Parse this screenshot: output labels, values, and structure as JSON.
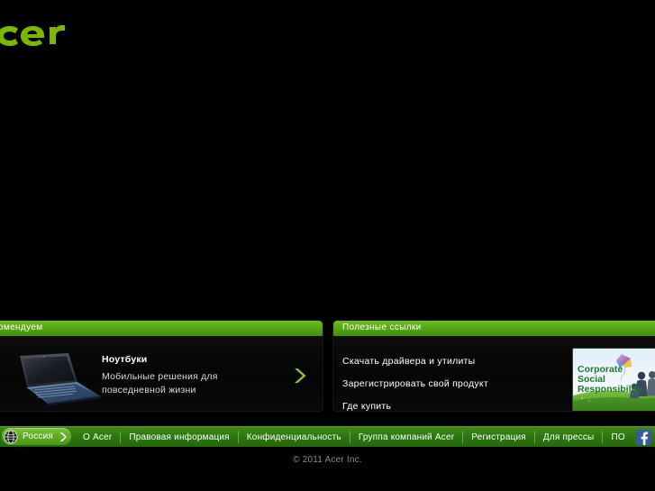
{
  "brand": {
    "logo_text": "acer",
    "logo_color": "#7ab800",
    "logo_name": "acer-logo"
  },
  "theme": {
    "background": "#000000",
    "accent_green": "#7ab800",
    "panel_header_green": "#56a714",
    "footer_green": "#2f7a10",
    "region_pill_green": "#5faa22",
    "facebook_blue": "#3b5998",
    "text_primary": "#ffffff",
    "text_muted": "#d8d8d8",
    "copyright_gray": "#8c8c8c"
  },
  "panels": {
    "recommended": {
      "header": "омендуем",
      "header_full": "Рекомендуем",
      "promo": {
        "title": "Ноутбуки",
        "description": "Мобильные решения для повседневной жизни",
        "thumbnail_name": "laptop-thumbnail",
        "arrow_name": "chevron-right-icon"
      }
    },
    "useful_links": {
      "header": "Полезные ссылки",
      "links": [
        "Скачать драйвера и утилиты",
        "Зарегистрировать свой продукт",
        "Где купить"
      ],
      "banner": {
        "line1": "Corporate",
        "line2": "Social",
        "line3": "Responsibility",
        "name": "csr-banner"
      }
    }
  },
  "footer": {
    "region": {
      "label": "Россия",
      "globe_icon": "globe-icon",
      "caret_icon": "chevron-right-icon"
    },
    "links": [
      "О Acer",
      "Правовая информация",
      "Конфиденциальность",
      "Группа компаний Acer",
      "Регистрация",
      "Для прессы",
      "ПО"
    ],
    "social": {
      "facebook_label": "f",
      "facebook_name": "facebook-icon"
    },
    "copyright": "© 2011 Acer Inc."
  }
}
